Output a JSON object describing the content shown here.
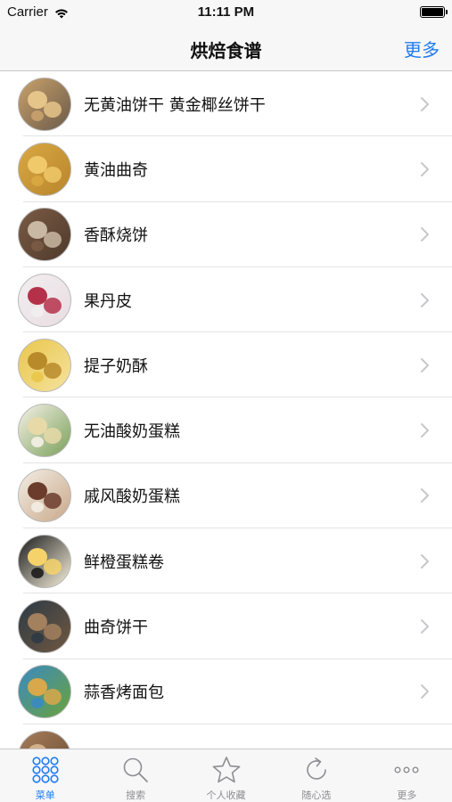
{
  "status_bar": {
    "carrier": "Carrier",
    "time": "11:11 PM"
  },
  "nav": {
    "title": "烘焙食谱",
    "more_label": "更多"
  },
  "recipes": [
    {
      "label": "无黄油饼干 黄金椰丝饼干",
      "icon": "recipe-thumbnail-coconut-cookies",
      "colors": [
        "#c8a26b",
        "#e6c58a",
        "#6b5a4a"
      ]
    },
    {
      "label": "黄油曲奇",
      "icon": "recipe-thumbnail-butter-cookies",
      "colors": [
        "#d9a842",
        "#f0c96a",
        "#b9852c"
      ]
    },
    {
      "label": "香酥烧饼",
      "icon": "recipe-thumbnail-flatbread",
      "colors": [
        "#7a5b45",
        "#c9b8a3",
        "#4f3a2c"
      ]
    },
    {
      "label": "果丹皮",
      "icon": "recipe-thumbnail-fruit-leather",
      "colors": [
        "#f2eef0",
        "#b5314a",
        "#e9dde2"
      ]
    },
    {
      "label": "提子奶酥",
      "icon": "recipe-thumbnail-raisin-crumble",
      "colors": [
        "#e9c64a",
        "#b98a2a",
        "#f5e3a0"
      ]
    },
    {
      "label": "无油酸奶蛋糕",
      "icon": "recipe-thumbnail-yogurt-cake",
      "colors": [
        "#f5f1e6",
        "#e8d9a8",
        "#7aa05a"
      ]
    },
    {
      "label": "戚风酸奶蛋糕",
      "icon": "recipe-thumbnail-chiffon-cake",
      "colors": [
        "#f3ede4",
        "#6b3b2b",
        "#c9a98a"
      ]
    },
    {
      "label": "鲜橙蛋糕卷",
      "icon": "recipe-thumbnail-orange-roll",
      "colors": [
        "#1c1c1c",
        "#f6d36a",
        "#f8f1dc"
      ]
    },
    {
      "label": "曲奇饼干",
      "icon": "recipe-thumbnail-cookies",
      "colors": [
        "#2d3a44",
        "#a3805e",
        "#6f5842"
      ]
    },
    {
      "label": "蒜香烤面包",
      "icon": "recipe-thumbnail-garlic-bread",
      "colors": [
        "#3a8ac2",
        "#d8a84a",
        "#6aa23a"
      ]
    },
    {
      "label": "",
      "icon": "recipe-thumbnail-partial",
      "colors": [
        "#a67c58",
        "#d2b08c",
        "#6a4e36"
      ]
    }
  ],
  "tabs": [
    {
      "label": "菜单",
      "icon": "grid-icon",
      "active": true
    },
    {
      "label": "搜索",
      "icon": "search-icon",
      "active": false
    },
    {
      "label": "个人收藏",
      "icon": "star-icon",
      "active": false
    },
    {
      "label": "随心选",
      "icon": "refresh-icon",
      "active": false
    },
    {
      "label": "更多",
      "icon": "more-icon",
      "active": false
    }
  ],
  "colors": {
    "accent": "#1e7cf2",
    "inactive": "#8e8e93"
  }
}
